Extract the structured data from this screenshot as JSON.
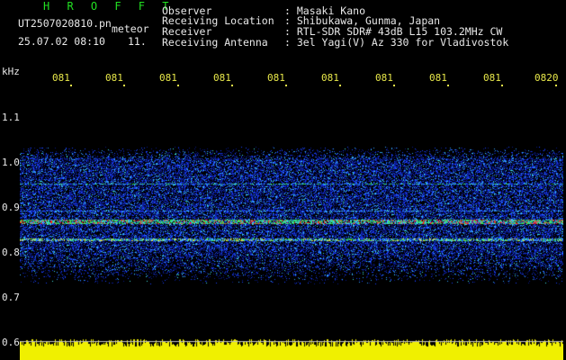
{
  "header": {
    "logo": "H R O F F T",
    "filename": "UT2507020810.pn",
    "meteor_label": "meteor",
    "datetime": "25.07.02 08:10",
    "count": "11.",
    "observer_label": "Observer",
    "observer_value": ": Masaki Kano",
    "location_label": "Receiving Location",
    "location_value": ": Shibukawa, Gunma, Japan",
    "receiver_label": "Receiver",
    "receiver_value": ": RTL-SDR SDR# 43dB L15 103.2MHz CW",
    "antenna_label": "Receiving Antenna",
    "antenna_value": ": 3el Yagi(V) Az 330 for Vladivostok"
  },
  "y_axis": {
    "unit": "kHz",
    "ticks": [
      "1.1",
      "1.0",
      "0.9",
      "0.8",
      "0.7",
      "0.6"
    ]
  },
  "x_axis": {
    "ticks": [
      "081",
      "081",
      "081",
      "081",
      "081",
      "081",
      "081",
      "081",
      "081",
      "0820"
    ]
  },
  "colors": {
    "background": "#000000",
    "logo": "#22e022",
    "tick_labels": "#e8e84a",
    "text": "#e8e8e8",
    "signal_peak": "#ff2020",
    "signal_mid": "#30e060",
    "noise": "#1a40ff",
    "noise_floor": "#f0f000"
  }
}
